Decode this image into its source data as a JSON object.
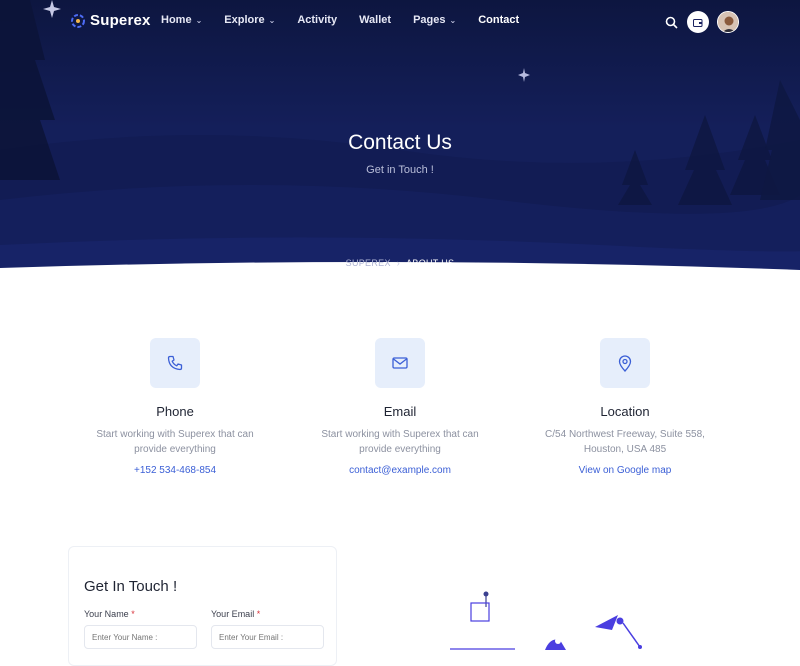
{
  "brand": {
    "name": "Superex"
  },
  "nav": {
    "items": [
      {
        "label": "Home",
        "dropdown": true
      },
      {
        "label": "Explore",
        "dropdown": true
      },
      {
        "label": "Activity",
        "dropdown": false
      },
      {
        "label": "Wallet",
        "dropdown": false
      },
      {
        "label": "Pages",
        "dropdown": true
      },
      {
        "label": "Contact",
        "dropdown": false,
        "active": true
      }
    ],
    "icons": [
      "search-icon",
      "wallet-icon",
      "avatar"
    ]
  },
  "hero": {
    "title": "Contact Us",
    "subtitle": "Get in Touch !",
    "breadcrumb": {
      "root": "SUPEREX",
      "separator": "›",
      "current": "ABOUT US"
    }
  },
  "contact_cards": [
    {
      "icon": "phone-icon",
      "title": "Phone",
      "desc": "Start working with Superex that can provide everything",
      "link": "+152 534-468-854"
    },
    {
      "icon": "mail-icon",
      "title": "Email",
      "desc": "Start working with Superex that can provide everything",
      "link": "contact@example.com"
    },
    {
      "icon": "map-pin-icon",
      "title": "Location",
      "desc": "C/54 Northwest Freeway, Suite 558, Houston, USA 485",
      "link": "View on Google map"
    }
  ],
  "form": {
    "title": "Get In Touch !",
    "name_label": "Your Name",
    "name_placeholder": "Enter Your Name :",
    "email_label": "Your Email",
    "email_placeholder": "Enter Your Email :",
    "required_mark": "*"
  },
  "colors": {
    "hero_bg": "#141f5a",
    "accent": "#3b5fd6",
    "icon_bg": "#e6eefb",
    "illustration": "#4a3ee0"
  }
}
